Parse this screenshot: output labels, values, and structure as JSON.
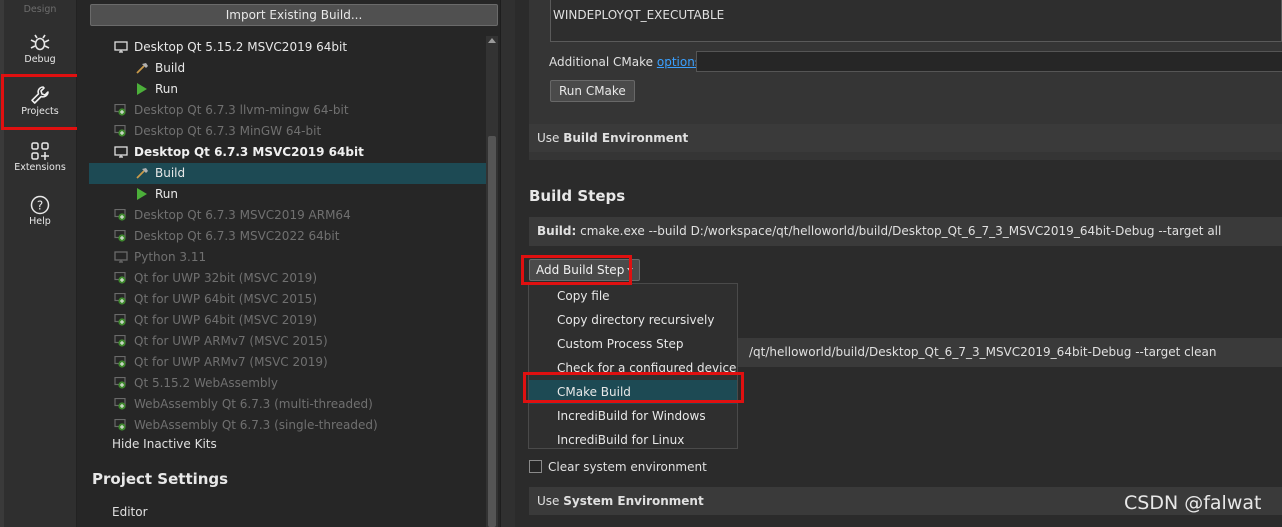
{
  "modebar": {
    "design": "Design",
    "debug": "Debug",
    "projects": "Projects",
    "extensions": "Extensions",
    "help": "Help"
  },
  "tree": {
    "import_button": "Import Existing Build...",
    "kits": [
      {
        "label": "Desktop Qt 5.15.2 MSVC2019 64bit",
        "state": "active",
        "icon": "monitor-icon"
      },
      {
        "label": "Build",
        "state": "child",
        "icon": "hammer-icon"
      },
      {
        "label": "Run",
        "state": "child",
        "icon": "play-icon"
      },
      {
        "label": "Desktop Qt 6.7.3 llvm-mingw 64-bit",
        "state": "inactive",
        "icon": "add-kit-icon"
      },
      {
        "label": "Desktop Qt 6.7.3 MinGW 64-bit",
        "state": "inactive",
        "icon": "add-kit-icon"
      },
      {
        "label": "Desktop Qt 6.7.3 MSVC2019 64bit",
        "state": "bold",
        "icon": "monitor-icon"
      },
      {
        "label": "Build",
        "state": "selected",
        "icon": "hammer-icon"
      },
      {
        "label": "Run",
        "state": "child",
        "icon": "play-icon"
      },
      {
        "label": "Desktop Qt 6.7.3 MSVC2019 ARM64",
        "state": "inactive",
        "icon": "add-kit-icon"
      },
      {
        "label": "Desktop Qt 6.7.3 MSVC2022 64bit",
        "state": "inactive",
        "icon": "add-kit-icon"
      },
      {
        "label": "Python 3.11",
        "state": "inactive",
        "icon": "monitor-icon"
      },
      {
        "label": "Qt  for UWP 32bit (MSVC 2019)",
        "state": "inactive",
        "icon": "add-kit-icon"
      },
      {
        "label": "Qt  for UWP 64bit (MSVC 2015)",
        "state": "inactive",
        "icon": "add-kit-icon"
      },
      {
        "label": "Qt  for UWP 64bit (MSVC 2019)",
        "state": "inactive",
        "icon": "add-kit-icon"
      },
      {
        "label": "Qt  for UWP ARMv7 (MSVC 2015)",
        "state": "inactive",
        "icon": "add-kit-icon"
      },
      {
        "label": "Qt  for UWP ARMv7 (MSVC 2019)",
        "state": "inactive",
        "icon": "add-kit-icon"
      },
      {
        "label": "Qt 5.15.2 WebAssembly",
        "state": "inactive",
        "icon": "add-kit-icon"
      },
      {
        "label": "WebAssembly Qt 6.7.3 (multi-threaded)",
        "state": "inactive",
        "icon": "add-kit-icon"
      },
      {
        "label": "WebAssembly Qt 6.7.3 (single-threaded)",
        "state": "inactive",
        "icon": "add-kit-icon"
      }
    ],
    "hide_inactive": "Hide Inactive Kits",
    "project_settings": "Project Settings",
    "editor": "Editor"
  },
  "content": {
    "variable_value": "WINDEPLOYQT_EXECUTABLE",
    "additional_cmake_prefix": "Additional CMake ",
    "additional_cmake_link": "options",
    "additional_cmake_suffix": ":",
    "run_cmake": "Run CMake",
    "use_build_env_prefix": "Use ",
    "use_build_env_bold": "Build Environment",
    "build_steps_title": "Build Steps",
    "build_step_label": "Build:",
    "build_step_cmd": " cmake.exe --build D:/workspace/qt/helloworld/build/Desktop_Qt_6_7_3_MSVC2019_64bit-Debug --target all",
    "add_build_step": "Add Build Step",
    "clean_step_cmd": "/qt/helloworld/build/Desktop_Qt_6_7_3_MSVC2019_64bit-Debug --target clean",
    "clear_env": "Clear system environment",
    "use_sys_env_prefix": "Use ",
    "use_sys_env_bold": "System Environment"
  },
  "menu": {
    "items": [
      "Copy file",
      "Copy directory recursively",
      "Custom Process Step",
      "Check for a configured device",
      "CMake Build",
      "IncrediBuild for Windows",
      "IncrediBuild for Linux"
    ],
    "highlighted_index": 4
  },
  "watermark": "CSDN @falwat",
  "colors": {
    "selection": "#1d4a54",
    "highlight_box": "#e01010",
    "link": "#3aa0ff"
  }
}
